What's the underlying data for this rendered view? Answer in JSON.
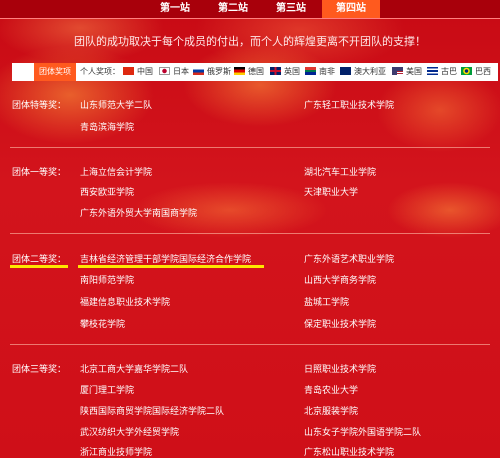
{
  "tabs": [
    "第一站",
    "第二站",
    "第三站",
    "第四站"
  ],
  "slogan": "团队的成功取决于每个成员的付出，而个人的辉煌更离不开团队的支撑！",
  "nav": {
    "team": "团体奖项",
    "individual": "个人奖项：",
    "countries": [
      "中国",
      "日本",
      "俄罗斯",
      "德国",
      "英国",
      "南非",
      "澳大利亚",
      "美国",
      "古巴",
      "巴西"
    ]
  },
  "sections": [
    {
      "label": "团体特等奖：",
      "left": [
        "山东师范大学二队",
        "青岛滨海学院"
      ],
      "right": [
        "广东轻工职业技术学院"
      ]
    },
    {
      "label": "团体一等奖：",
      "left": [
        "上海立信会计学院",
        "西安欧亚学院",
        "广东外语外贸大学南国商学院"
      ],
      "right": [
        "湖北汽车工业学院",
        "天津职业大学"
      ]
    },
    {
      "label": "团体二等奖：",
      "left": [
        "吉林省经济管理干部学院国际经济合作学院",
        "南阳师范学院",
        "福建信息职业技术学院",
        "攀枝花学院"
      ],
      "right": [
        "广东外语艺术职业学院",
        "山西大学商务学院",
        "盐城工学院",
        "保定职业技术学院"
      ]
    },
    {
      "label": "团体三等奖：",
      "left": [
        "北京工商大学嘉华学院二队",
        "厦门理工学院",
        "陕西国际商贸学院国际经济学院二队",
        "武汉纺织大学外经贸学院",
        "浙江商业技师学院"
      ],
      "right": [
        "日照职业技术学院",
        "青岛农业大学",
        "北京服装学院",
        "山东女子学院外国语学院二队",
        "广东松山职业技术学院"
      ]
    }
  ]
}
